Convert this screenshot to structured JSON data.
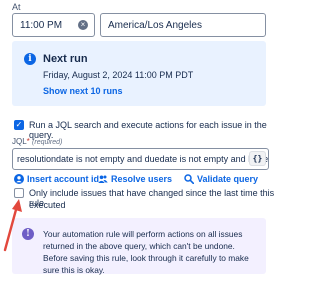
{
  "schedule": {
    "at_label": "At",
    "time_value": "11:00 PM",
    "timezone_value": "America/Los Angeles"
  },
  "next_run": {
    "title": "Next run",
    "date": "Friday, August 2, 2024 11:00 PM PDT",
    "link": "Show next 10 runs"
  },
  "jql_option": {
    "checked": true,
    "label": "Run a JQL search and execute actions for each issue in the query."
  },
  "jql": {
    "label": "JQL",
    "required_marker": "*",
    "required_hint": "(required)",
    "value": "resolutiondate is not empty and duedate is not empty and Labels",
    "format_button": "{}"
  },
  "actions": {
    "insert_account_id": "Insert account id",
    "resolve_users": "Resolve users",
    "validate_query": "Validate query"
  },
  "changed_option": {
    "checked": false,
    "label_line1": "Only include issues that have changed since the last time this rule",
    "label_line2": "executed"
  },
  "warning": {
    "text": "Your automation rule will perform actions on all issues returned in the above query, which can't be undone. Before saving this rule, look through it carefully to make sure this is okay."
  },
  "colors": {
    "accent": "#0c66e4",
    "info_bg": "#e9f2ff",
    "warning_bg": "#f3f0ff",
    "annotation_arrow": "#e2483d"
  }
}
